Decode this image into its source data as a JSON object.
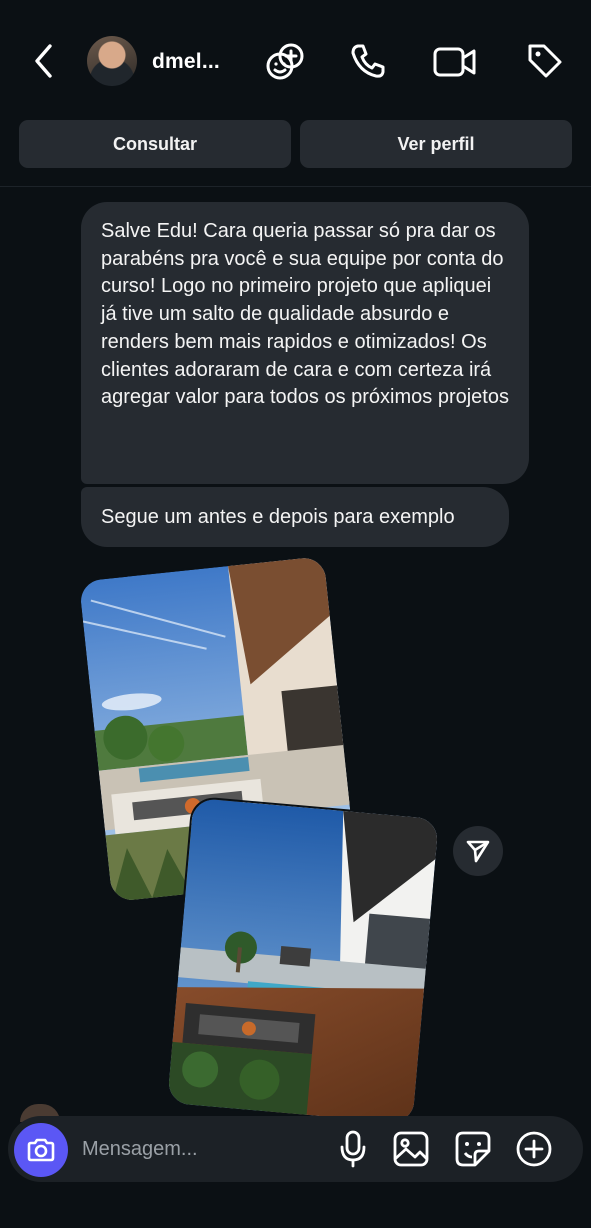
{
  "header": {
    "username": "dmel...",
    "icons": [
      "back-chevron-icon",
      "add-people-icon",
      "phone-icon",
      "video-camera-icon",
      "tag-icon"
    ]
  },
  "actions": {
    "consult_label": "Consultar",
    "profile_label": "Ver perfil"
  },
  "messages": [
    {
      "text": "Salve Edu! Cara queria passar só pra dar os parabéns pra você e sua equipe por conta do curso! Logo no primeiro projeto que apliquei já tive um salto de qualidade absurdo e renders bem mais rapidos e otimizados! Os clientes adoraram de cara e com certeza irá agregar valor para todos os próximos projetos"
    },
    {
      "text": "Segue um antes e depois para exemplo"
    }
  ],
  "composer": {
    "placeholder": "Mensagem...",
    "icons": [
      "camera-icon",
      "microphone-icon",
      "gallery-icon",
      "sticker-icon",
      "plus-circle-icon"
    ]
  },
  "colors": {
    "background": "#0b1014",
    "bubble": "#262b31",
    "accent": "#5b57f5"
  }
}
